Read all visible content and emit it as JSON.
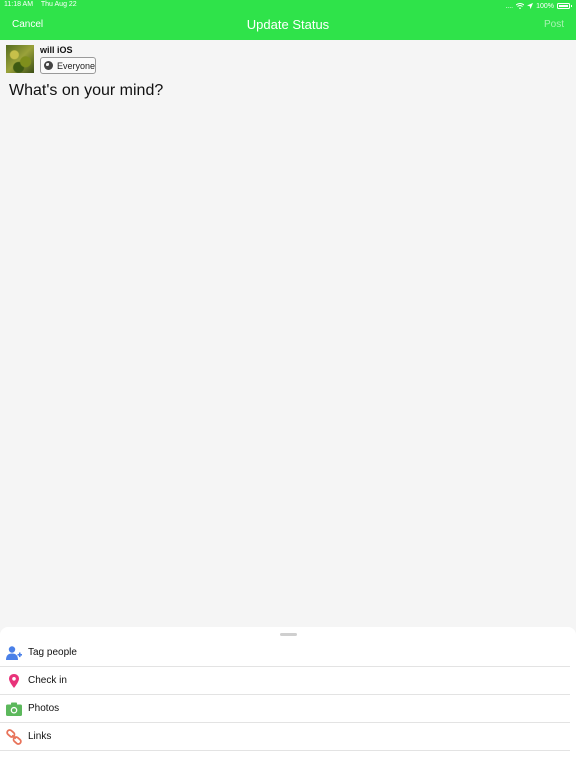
{
  "status_bar": {
    "time": "11:18 AM",
    "date": "Thu Aug 22",
    "signal": "....",
    "battery": "100%"
  },
  "nav": {
    "cancel_label": "Cancel",
    "title": "Update Status",
    "post_label": "Post"
  },
  "composer": {
    "username": "will iOS",
    "audience": "Everyone",
    "prompt": "What's on your mind?"
  },
  "options": [
    {
      "label": "Tag people",
      "icon": "tag-people-icon",
      "color": "#4a80e8"
    },
    {
      "label": "Check in",
      "icon": "location-pin-icon",
      "color": "#e8337a"
    },
    {
      "label": "Photos",
      "icon": "camera-icon",
      "color": "#5cb85c"
    },
    {
      "label": "Links",
      "icon": "link-icon",
      "color": "#e8735a"
    }
  ],
  "colors": {
    "accent": "#2fe34a",
    "background": "#f5f5f5"
  }
}
